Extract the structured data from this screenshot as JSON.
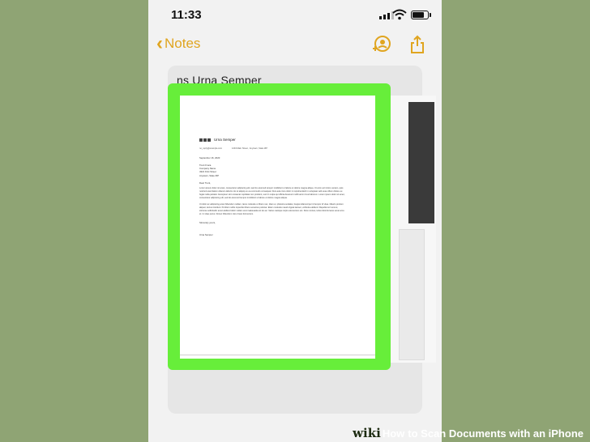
{
  "status_bar": {
    "time": "11:33"
  },
  "nav": {
    "back_label": "Notes"
  },
  "note": {
    "title": "ns Urna Semper"
  },
  "letter": {
    "sender_name": "Urna Semper",
    "sender_email": "no_reply@example.com",
    "sender_address": "1234 Main Street , Anytown, State ZIP",
    "date": "September 16, 2020",
    "recipient_address": "Trent Fruca\nCompany Name\n4321 First Street\nAnytown, State ZIP",
    "greeting": "Dear Trent,",
    "paragraph1": "Lorem ipsum dolor sit amet, consectetur adipiscing elit, sed do eiusmod tempor incididunt ut labore et dolore magna aliqua. Ut enim ad minim veniam, quis nostrud exercitation ullamco laboris nisi ut aliquip ex ea commodo consequat. Duis aute irure dolor in reprehenderit in voluptate velit esse cillum dolore eu fugiat nulla pariatur. Excepteur sint occaecat cupidatat non proident, sunt in culpa qui officia deserunt mollit anim id est laborum. Lorem ipsum dolor sit amet, consectetur adipiscing elit, sed do eiusmod tempor incididunt ut labore et dolore magna aliqua.",
    "paragraph2": "Ut dolor ac adipiscing amet bibendum nullam, lacus molestie ut libero nec, diam et, pharetra sodales, feugiat ullamcorper id tempor id vitae. Mauris pretium aliquet, lectus tincidunt. Porttitor mollis imperdiet libero senectus pulvinar. Etiam molestie mauris ligula laoreet, vehicula eleifend. Repellat orci erat et, sitconse sollicitudin amet eleifend dolor nullam erat malesuada est leo ac. Varius natoque turpis elementum est. Duis montes, tellus lobortis lacus amet arcu et. In vitae purus. Donec bibendum nisi ornare fermentum.",
    "closing": "Sincerely yours,",
    "signature": "Urna Semper"
  },
  "watermark": {
    "brand": "wiki",
    "how": "How",
    "title": "to Scan Documents with an iPhone"
  },
  "colors": {
    "accent": "#e0a520",
    "scan_highlight": "#67ee3a",
    "background": "#8fa474"
  },
  "icons": [
    "signal-icon",
    "wifi-icon",
    "battery-icon",
    "chevron-left-icon",
    "add-collaborator-icon",
    "share-icon",
    "logo-icon"
  ]
}
